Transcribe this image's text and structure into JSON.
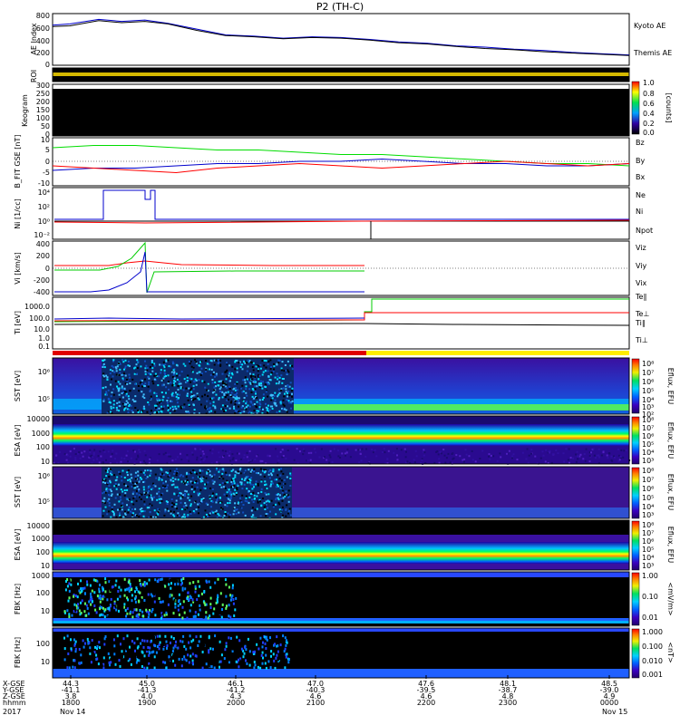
{
  "title": "P2 (TH-C)",
  "chart_data": [
    {
      "type": "line",
      "ylabel": "AE Index",
      "yticks": [
        "800",
        "600",
        "400",
        "200",
        "0"
      ],
      "ylim": [
        0,
        800
      ],
      "series": [
        {
          "name": "Kyoto AE",
          "color": "#0000cc",
          "x": [
            0,
            0.03,
            0.08,
            0.12,
            0.16,
            0.2,
            0.25,
            0.3,
            0.35,
            0.4,
            0.45,
            0.5,
            0.55,
            0.6,
            0.65,
            0.7,
            0.75,
            0.8,
            0.85,
            0.9,
            0.95,
            1.0
          ],
          "values": [
            620,
            640,
            710,
            680,
            700,
            650,
            560,
            470,
            450,
            420,
            440,
            430,
            400,
            360,
            340,
            300,
            280,
            250,
            230,
            200,
            180,
            160
          ]
        },
        {
          "name": "Themis AE",
          "color": "#000000",
          "x": [
            0,
            0.03,
            0.08,
            0.12,
            0.16,
            0.2,
            0.25,
            0.3,
            0.35,
            0.4,
            0.45,
            0.5,
            0.55,
            0.6,
            0.65,
            0.7,
            0.75,
            0.8,
            0.85,
            0.9,
            0.95,
            1.0
          ],
          "values": [
            600,
            610,
            690,
            660,
            680,
            640,
            540,
            460,
            440,
            410,
            430,
            420,
            390,
            350,
            330,
            290,
            260,
            240,
            210,
            190,
            170,
            150
          ]
        }
      ]
    },
    {
      "type": "heatmap",
      "ylabel": "ROI"
    },
    {
      "type": "heatmap",
      "ylabel": "Keogram",
      "yticks": [
        "300",
        "250",
        "200",
        "150",
        "100",
        "50",
        "0"
      ],
      "colorbar": {
        "ticks": [
          "1.0",
          "0.8",
          "0.6",
          "0.4",
          "0.2",
          "0.0"
        ],
        "label": "[counts]"
      }
    },
    {
      "type": "line",
      "ylabel": "B_FIT GSE [nT]",
      "yticks": [
        "10",
        "5",
        "0",
        "-5",
        "-10"
      ],
      "ylim": [
        -10,
        10
      ],
      "series": [
        {
          "name": "Bz",
          "color": "#ff0000",
          "values": [
            -2,
            -3,
            -4,
            -5,
            -3,
            -2,
            -1,
            -2,
            -3,
            -2,
            -1,
            0,
            -1,
            -2,
            -1
          ]
        },
        {
          "name": "By",
          "color": "#00cc00",
          "values": [
            6,
            7,
            7,
            6,
            5,
            5,
            4,
            3,
            3,
            2,
            1,
            0,
            -1,
            -1,
            -2
          ]
        },
        {
          "name": "Bx",
          "color": "#0000cc",
          "values": [
            -4,
            -3,
            -3,
            -2,
            -1,
            -1,
            0,
            0,
            1,
            0,
            -1,
            -1,
            -2,
            -2,
            -1
          ]
        }
      ]
    },
    {
      "type": "line",
      "ylabel": "Ni [1/cc]",
      "yticks": [
        "10⁴",
        "10²",
        "10⁰",
        "10⁻²"
      ],
      "series": [
        {
          "name": "Ne",
          "color": "#ff0000"
        },
        {
          "name": "Ni",
          "color": "#000000"
        },
        {
          "name": "Npot",
          "color": "#0000cc"
        }
      ]
    },
    {
      "type": "line",
      "ylabel": "Vi [km/s]",
      "yticks": [
        "400",
        "200",
        "0",
        "-200",
        "-400"
      ],
      "ylim": [
        -400,
        400
      ],
      "series": [
        {
          "name": "Viz",
          "color": "#ff0000"
        },
        {
          "name": "Viy",
          "color": "#00cc00"
        },
        {
          "name": "Vix",
          "color": "#0000cc"
        }
      ]
    },
    {
      "type": "line",
      "ylabel": "Ti [eV]",
      "yticks": [
        "1000.0",
        "100.0",
        "10.0",
        "1.0",
        "0.1"
      ],
      "series": [
        {
          "name": "Te∥",
          "color": "#000000"
        },
        {
          "name": "Te⊥",
          "color": "#ff0000"
        },
        {
          "name": "Ti∥",
          "color": "#00cc00"
        },
        {
          "name": "Ti⊥",
          "color": "#0000cc"
        }
      ]
    },
    {
      "type": "heatmap",
      "ylabel": "SST [eV]",
      "yticks": [
        "10⁶",
        "10⁵"
      ],
      "colorbar": {
        "ticks": [
          "10⁸",
          "10⁷",
          "10⁶",
          "10⁵",
          "10⁴",
          "10³",
          "10²"
        ],
        "label": "Eflux, EFU"
      }
    },
    {
      "type": "heatmap",
      "ylabel": "ESA [eV]",
      "yticks": [
        "10000",
        "1000",
        "100",
        "10"
      ],
      "colorbar": {
        "ticks": [
          "10⁸",
          "10⁷",
          "10⁶",
          "10⁵",
          "10⁴",
          "10³"
        ],
        "label": "Eflux, EFU"
      }
    },
    {
      "type": "heatmap",
      "ylabel": "SST [eV]",
      "yticks": [
        "10⁶",
        "10⁵"
      ],
      "colorbar": {
        "ticks": [
          "10⁸",
          "10⁷",
          "10⁶",
          "10⁵",
          "10⁴",
          "10³"
        ],
        "label": "Eflux, EFU"
      }
    },
    {
      "type": "heatmap",
      "ylabel": "ESA [eV]",
      "yticks": [
        "10000",
        "1000",
        "100",
        "10"
      ],
      "colorbar": {
        "ticks": [
          "10⁸",
          "10⁷",
          "10⁶",
          "10⁵",
          "10⁴",
          "10³"
        ],
        "label": "Eflux, EFU"
      }
    },
    {
      "type": "heatmap",
      "ylabel": "FBK [Hz]",
      "yticks": [
        "1000",
        "100",
        "10"
      ],
      "colorbar": {
        "ticks": [
          "1.00",
          "0.10",
          "0.01"
        ],
        "label": "<mV/m>"
      }
    },
    {
      "type": "heatmap",
      "ylabel": "FBK [Hz]",
      "yticks": [
        "100",
        "10"
      ],
      "colorbar": {
        "ticks": [
          "1.000",
          "0.100",
          "0.010",
          "0.001"
        ],
        "label": "<nT>"
      }
    }
  ],
  "xaxis": {
    "rows": [
      {
        "label": "X-GSE",
        "values": [
          "44.3",
          "45.0",
          "46.1",
          "47.0",
          "47.6",
          "48.1",
          "48.5"
        ]
      },
      {
        "label": "Y-GSE",
        "values": [
          "-41.1",
          "-41.3",
          "-41.2",
          "-40.3",
          "-39.5",
          "-38.7",
          "-39.0"
        ]
      },
      {
        "label": "Z-GSE",
        "values": [
          "3.8",
          "4.0",
          "4.3",
          "4.6",
          "4.6",
          "4.8",
          "4.9"
        ]
      },
      {
        "label": "hhmm",
        "values": [
          "1800",
          "1900",
          "2000",
          "2100",
          "2200",
          "2300",
          "0000"
        ]
      }
    ],
    "date_left": "2017",
    "date_left2": "Nov 14",
    "date_right": "Nov 15"
  }
}
